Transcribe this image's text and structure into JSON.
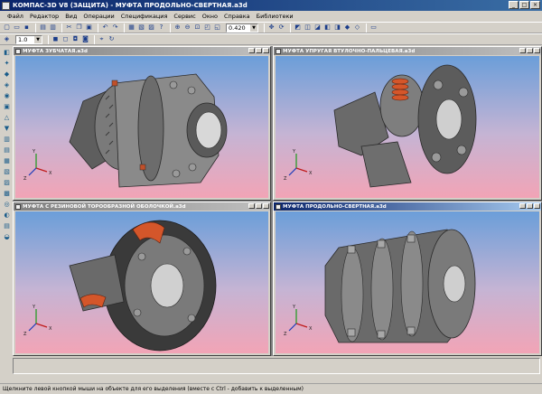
{
  "window": {
    "title": "КОМПАС-3D V8 (ЗАЩИТА) - МУФТА ПРОДОЛЬНО-СВЕРТНАЯ.a3d"
  },
  "menu": [
    "Файл",
    "Редактор",
    "Вид",
    "Операции",
    "Спецификация",
    "Сервис",
    "Окно",
    "Справка",
    "Библиотеки"
  ],
  "toolbar": {
    "scale_value": "1.0",
    "zoom_value": "0.420"
  },
  "documents": [
    {
      "title": "МУФТА ЗУБЧАТАЯ.a3d"
    },
    {
      "title": "МУФТА УПРУГАЯ ВТУЛОЧНО-ПАЛЬЦЕВАЯ.a3d"
    },
    {
      "title": "МУФТА С РЕЗИНОВОЙ ТОРООБРАЗНОЙ ОБОЛОЧКОЙ.a3d"
    },
    {
      "title": "МУФТА ПРОДОЛЬНО-СВЕРТНАЯ.a3d"
    }
  ],
  "axes": {
    "x": "X",
    "y": "Y",
    "z": "Z"
  },
  "status": {
    "hint": "Щелкните левой кнопкой мыши на объекте для его выделения (вместе с Ctrl - добавить к выделенным)"
  },
  "colors": {
    "title_active": "#0a246a",
    "viewport_top": "#6b9ed9",
    "viewport_bottom": "#f2a4b6",
    "part_gray": "#7a7a7a",
    "spring_orange": "#d4562a"
  }
}
